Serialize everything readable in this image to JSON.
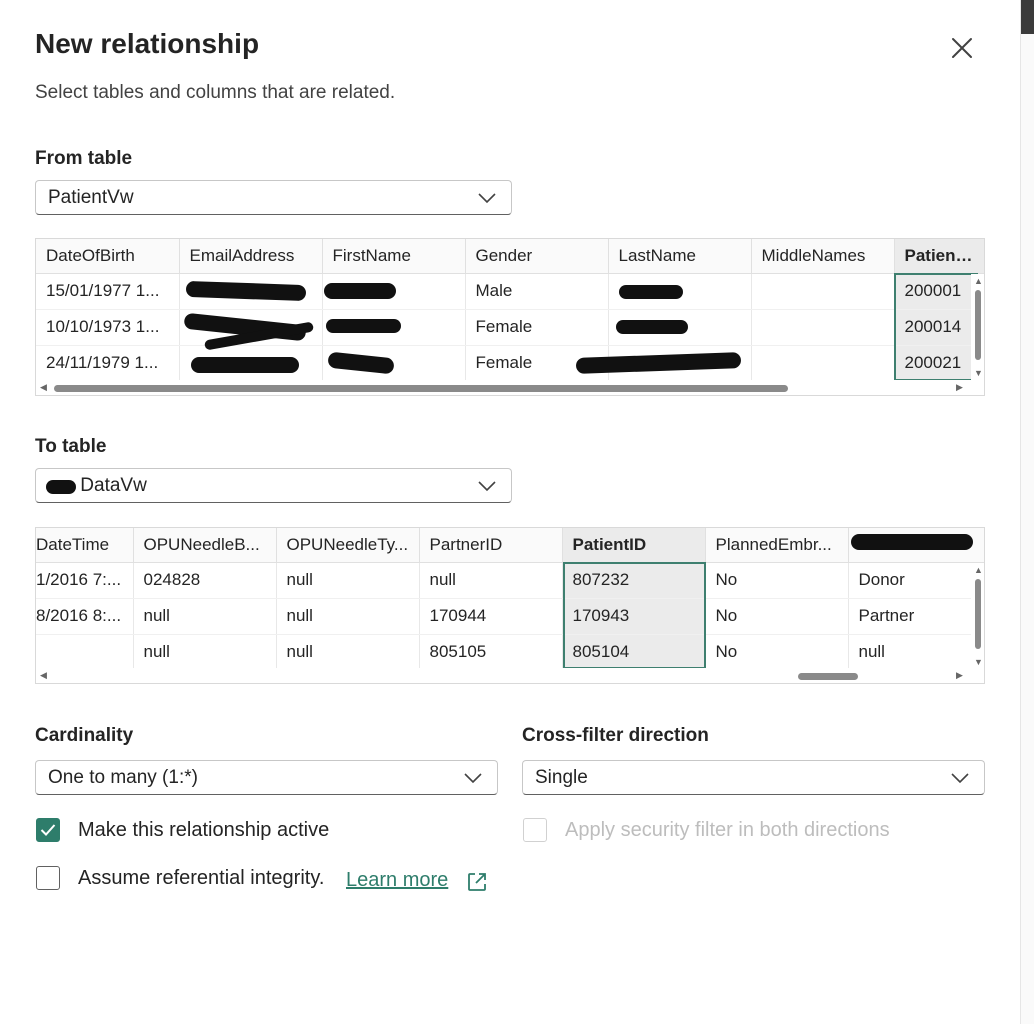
{
  "dialog": {
    "title": "New relationship",
    "subtitle": "Select tables and columns that are related."
  },
  "from_table": {
    "label": "From table",
    "selected": "PatientVw",
    "columns": [
      "DateOfBirth",
      "EmailAddress",
      "FirstName",
      "Gender",
      "LastName",
      "MiddleNames",
      "PatientId"
    ],
    "selected_column": "PatientId",
    "rows": [
      [
        "15/01/1977 1...",
        "",
        "",
        "Male",
        "",
        "",
        "200001"
      ],
      [
        "10/10/1973 1...",
        "",
        "",
        "Female",
        "",
        "",
        "200014"
      ],
      [
        "24/11/1979 1...",
        "",
        "",
        "Female",
        "",
        "",
        "200021"
      ]
    ]
  },
  "to_table": {
    "label": "To table",
    "selected": "DataVw",
    "columns": [
      "DateTime",
      "OPUNeedleB...",
      "OPUNeedleTy...",
      "PartnerID",
      "PatientID",
      "PlannedEmbr...",
      ""
    ],
    "selected_column": "PatientID",
    "rows": [
      [
        "1/2016 7:...",
        "024828",
        "null",
        "null",
        "807232",
        "No",
        "Donor"
      ],
      [
        "8/2016 8:...",
        "null",
        "null",
        "170944",
        "170943",
        "No",
        "Partner"
      ],
      [
        "",
        "null",
        "null",
        "805105",
        "805104",
        "No",
        "null"
      ]
    ]
  },
  "cardinality": {
    "label": "Cardinality",
    "selected": "One to many (1:*)"
  },
  "cross_filter": {
    "label": "Cross-filter direction",
    "selected": "Single"
  },
  "options": {
    "make_active": {
      "label": "Make this relationship active",
      "checked": true
    },
    "security_filter": {
      "label": "Apply security filter in both directions",
      "checked": false,
      "disabled": true
    },
    "referential_integrity": {
      "label": "Assume referential integrity.",
      "checked": false
    },
    "learn_more": "Learn more"
  },
  "colors": {
    "accent": "#2e7d6b",
    "text": "#242424",
    "selected_cell": "#ebebeb"
  }
}
